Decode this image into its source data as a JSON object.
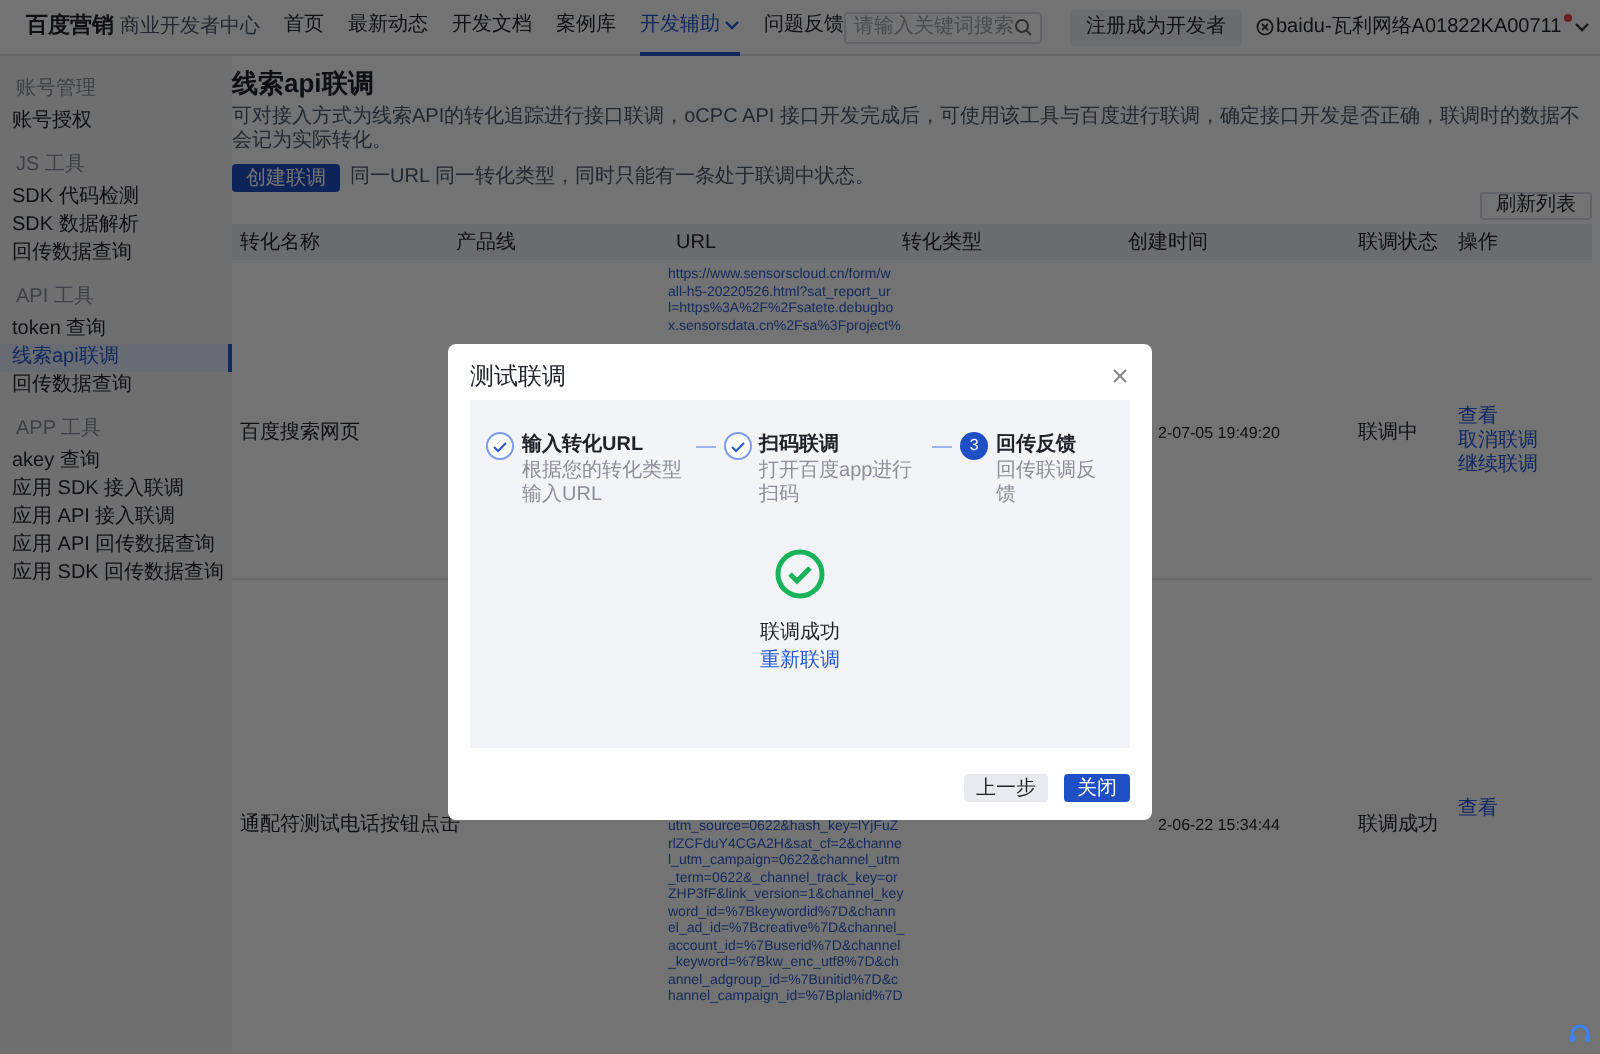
{
  "header": {
    "brand": "百度营销",
    "subtitle": "商业开发者中心",
    "nav": [
      {
        "label": "首页",
        "selected": false,
        "dropdown": false
      },
      {
        "label": "最新动态",
        "selected": false,
        "dropdown": false
      },
      {
        "label": "开发文档",
        "selected": false,
        "dropdown": false
      },
      {
        "label": "案例库",
        "selected": false,
        "dropdown": false
      },
      {
        "label": "开发辅助",
        "selected": true,
        "dropdown": true
      },
      {
        "label": "问题反馈",
        "selected": false,
        "dropdown": false
      }
    ],
    "search": {
      "placeholder": "请输入关键词搜索"
    },
    "register_button": "注册成为开发者",
    "user": {
      "name": "baidu-瓦利网络A01822KA00711",
      "notification": true
    }
  },
  "sidebar": {
    "groups": [
      {
        "title": "账号管理",
        "items": [
          {
            "label": "账号授权",
            "selected": false
          }
        ]
      },
      {
        "title": "JS 工具",
        "items": [
          {
            "label": "SDK 代码检测",
            "selected": false
          },
          {
            "label": "SDK 数据解析",
            "selected": false
          },
          {
            "label": "回传数据查询",
            "selected": false
          }
        ]
      },
      {
        "title": "API 工具",
        "items": [
          {
            "label": "token 查询",
            "selected": false
          },
          {
            "label": "线索api联调",
            "selected": true
          },
          {
            "label": "回传数据查询",
            "selected": false
          }
        ]
      },
      {
        "title": "APP 工具",
        "items": [
          {
            "label": "akey 查询",
            "selected": false
          },
          {
            "label": "应用 SDK 接入联调",
            "selected": false
          },
          {
            "label": "应用 API 接入联调",
            "selected": false
          },
          {
            "label": "应用 API 回传数据查询",
            "selected": false
          },
          {
            "label": "应用 SDK 回传数据查询",
            "selected": false
          }
        ]
      }
    ]
  },
  "page": {
    "title": "线索api联调",
    "description": "可对接入方式为线索API的转化追踪进行接口联调，oCPC API 接口开发完成后，可使用该工具与百度进行联调，确定接口开发是否正确，联调时的数据不会记为实际转化。",
    "create_button": "创建联调",
    "note": "同一URL 同一转化类型，同时只能有一条处于联调中状态。",
    "refresh_button": "刷新列表"
  },
  "table": {
    "columns": [
      "转化名称",
      "产品线",
      "URL",
      "转化类型",
      "创建时间",
      "联调状态",
      "操作"
    ],
    "rows": [
      {
        "name": "百度搜索网页",
        "url_lines": [
          "https://www.sensorscloud.cn/form/w",
          "all-h5-20220526.html?sat_report_ur",
          "l=https%3A%2F%2Fsatete.debugbo",
          "x.sensorsdata.cn%2Fsa%3Fproject%"
        ],
        "created": "2-07-05 19:49:20",
        "status": "联调中",
        "actions": [
          "查看",
          "取消联调",
          "继续联调"
        ]
      },
      {
        "name": "通配符测试电话按钮点击",
        "url_lines": [
          "utm_source=0622&hash_key=lYjFuZ",
          "rlZCFduY4CGA2H&sat_cf=2&channe",
          "l_utm_campaign=0622&channel_utm",
          "_term=0622&_channel_track_key=or",
          "ZHP3fF&link_version=1&channel_key",
          "word_id=%7Bkeywordid%7D&chann",
          "el_ad_id=%7Bcreative%7D&channel_",
          "account_id=%7Buserid%7D&channel",
          "_keyword=%7Bkw_enc_utf8%7D&ch",
          "annel_adgroup_id=%7Bunitid%7D&c",
          "hannel_campaign_id=%7Bplanid%7D"
        ],
        "created": "2-06-22 15:34:44",
        "status": "联调成功",
        "actions": [
          "查看"
        ]
      }
    ]
  },
  "modal": {
    "title": "测试联调",
    "steps": [
      {
        "title": "输入转化URL",
        "description": "根据您的转化类型输入URL",
        "completed": true
      },
      {
        "title": "扫码联调",
        "description": "打开百度app进行扫码",
        "completed": true
      },
      {
        "number": "3",
        "title": "回传反馈",
        "description": "回传联调反馈",
        "completed": false
      }
    ],
    "result": {
      "message": "联调成功",
      "link": "重新联调"
    },
    "buttons": [
      {
        "label": "上一步",
        "kind": "secondary"
      },
      {
        "label": "关闭",
        "kind": "primary"
      }
    ]
  }
}
